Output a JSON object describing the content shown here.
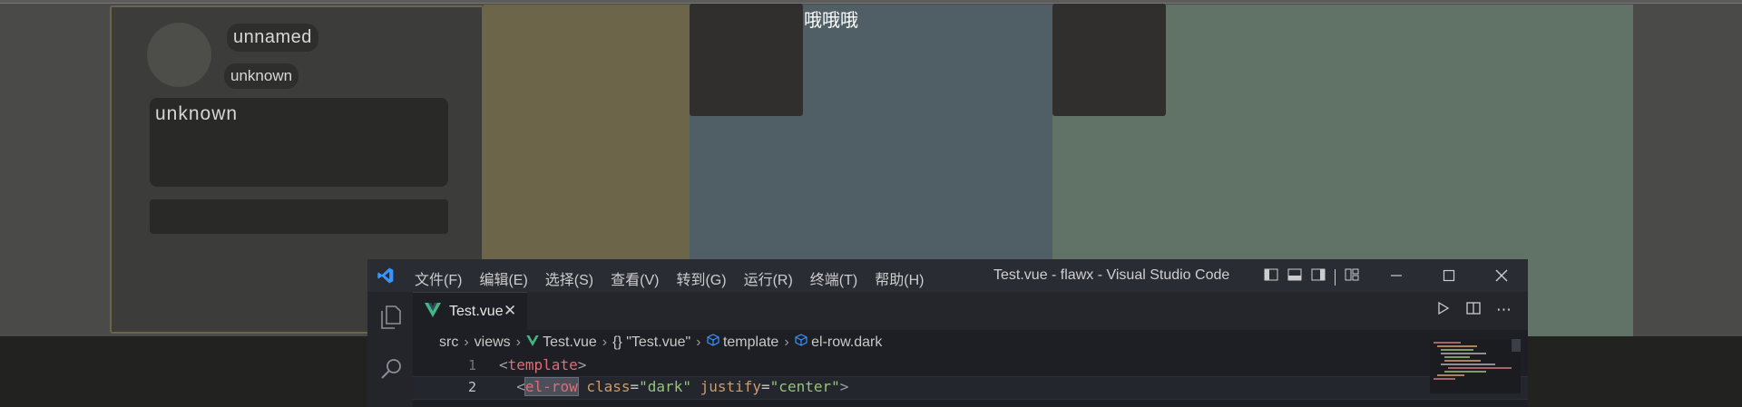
{
  "background_colors": {
    "page": "#4a4a48",
    "card": "#3c3c3a",
    "olive": "#6d654a",
    "slate": "#505f65",
    "sage": "#617367",
    "bottom": "#222221"
  },
  "card": {
    "name": "unnamed",
    "subtitle": "unknown",
    "description": "unknown"
  },
  "top_text": "哦哦哦",
  "vscode": {
    "menu": [
      "文件(F)",
      "编辑(E)",
      "选择(S)",
      "查看(V)",
      "转到(G)",
      "运行(R)",
      "终端(T)",
      "帮助(H)"
    ],
    "window_title": "Test.vue - flawx - Visual Studio Code",
    "tab": {
      "label": "Test.vue",
      "icon": "vue-icon"
    },
    "breadcrumb": [
      "src",
      "views",
      "Test.vue",
      "\"Test.vue\"",
      "template",
      "el-row.dark"
    ],
    "code": {
      "line1_num": "1",
      "line2_num": "2",
      "line1_open": "<",
      "line1_tag": "template",
      "line1_close": ">",
      "line2_open": "<",
      "line2_tag": "el-row",
      "line2_attr1": "class",
      "line2_eq1": "=",
      "line2_val1": "\"dark\"",
      "line2_attr2": "justify",
      "line2_eq2": "=",
      "line2_val2": "\"center\"",
      "line2_close": ">"
    },
    "accent": "#3794ff"
  }
}
